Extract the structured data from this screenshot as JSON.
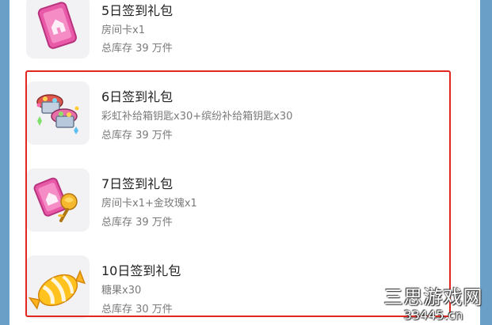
{
  "items": [
    {
      "title": "5日签到礼包",
      "desc": "房间卡x1",
      "stock": "总库存 39 万件",
      "icon": "room-card-icon"
    },
    {
      "title": "6日签到礼包",
      "desc": "彩虹补给箱钥匙x30+缤纷补给箱钥匙x30",
      "stock": "总库存 39 万件",
      "icon": "supply-keys-icon"
    },
    {
      "title": "7日签到礼包",
      "desc": "房间卡x1+金玫瑰x1",
      "stock": "总库存 39 万件",
      "icon": "room-card-gold-rose-icon"
    },
    {
      "title": "10日签到礼包",
      "desc": "糖果x30",
      "stock": "总库存 30 万件",
      "icon": "candy-icon"
    }
  ],
  "watermark": {
    "name": "三思游戏网",
    "url": "33445.cn"
  },
  "colors": {
    "background": "#6a9fc8",
    "highlight": "#e3261f",
    "title": "#222222",
    "subtext": "#7a7a7a"
  }
}
